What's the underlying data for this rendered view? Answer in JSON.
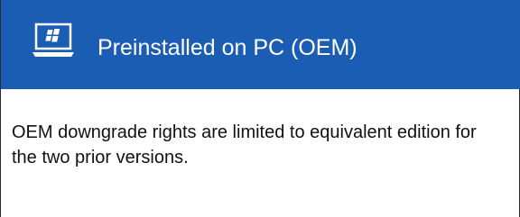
{
  "header": {
    "title": "Preinstalled on PC (OEM)",
    "icon": "laptop-windows-icon",
    "background_color": "#1c5db4",
    "text_color": "#ffffff"
  },
  "body": {
    "text": "OEM downgrade rights are limited to equivalent edition for the two prior versions.",
    "text_color": "#111111"
  }
}
